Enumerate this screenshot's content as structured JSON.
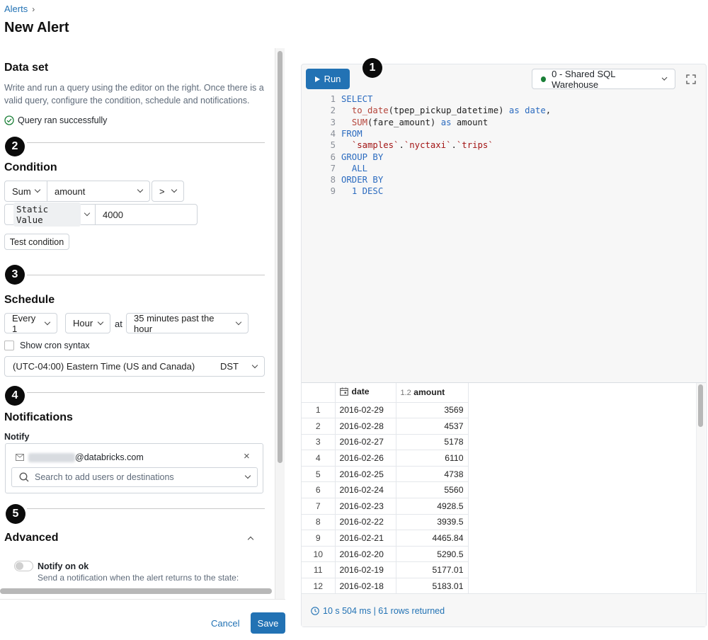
{
  "breadcrumb": {
    "parent": "Alerts",
    "separator": "›"
  },
  "page_title": "New Alert",
  "dataset": {
    "title": "Data set",
    "description": "Write and run a query using the editor on the right. Once there is a valid query, configure the condition, schedule and notifications.",
    "description_line1": "Write and run a query using the editor on the right. Once there is a",
    "description_line2": "valid query, configure the condition, schedule and notifications.",
    "status": "Query ran successfully"
  },
  "badges": [
    "1",
    "2",
    "3",
    "4",
    "5"
  ],
  "condition": {
    "title": "Condition",
    "aggregation": "Sum",
    "column": "amount",
    "operator": ">",
    "value_type": "Static Value",
    "value": "4000",
    "test_button": "Test condition"
  },
  "schedule": {
    "title": "Schedule",
    "every": "Every 1",
    "unit": "Hour",
    "at_label": "at",
    "minutes": "35 minutes past the hour",
    "cron_label": "Show cron syntax",
    "timezone": "(UTC-04:00) Eastern Time (US and Canada)",
    "dst": "DST"
  },
  "notifications": {
    "title": "Notifications",
    "notify_label": "Notify",
    "email_suffix": "@databricks.com",
    "search_placeholder": "Search to add users or destinations"
  },
  "advanced": {
    "title": "Advanced",
    "notify_ok_title": "Notify on ok",
    "notify_ok_desc": "Send a notification when the alert returns to the state:"
  },
  "footer": {
    "cancel": "Cancel",
    "save": "Save"
  },
  "editor": {
    "run_label": "Run",
    "warehouse": "0 - Shared SQL Warehouse",
    "lines": [
      {
        "n": "1",
        "parts": [
          [
            "kw",
            "SELECT"
          ]
        ]
      },
      {
        "n": "2",
        "parts": [
          [
            "txt",
            "  "
          ],
          [
            "fn",
            "to_date"
          ],
          [
            "txt",
            "(tpep_pickup_datetime) "
          ],
          [
            "kw",
            "as date"
          ],
          [
            "txt",
            ","
          ]
        ]
      },
      {
        "n": "3",
        "parts": [
          [
            "txt",
            "  "
          ],
          [
            "fn",
            "SUM"
          ],
          [
            "txt",
            "(fare_amount) "
          ],
          [
            "kw",
            "as"
          ],
          [
            "txt",
            " amount"
          ]
        ]
      },
      {
        "n": "4",
        "parts": [
          [
            "kw",
            "FROM"
          ]
        ]
      },
      {
        "n": "5",
        "parts": [
          [
            "txt",
            "  "
          ],
          [
            "str",
            "`samples`"
          ],
          [
            "txt",
            "."
          ],
          [
            "str",
            "`nyctaxi`"
          ],
          [
            "txt",
            "."
          ],
          [
            "str",
            "`trips`"
          ]
        ]
      },
      {
        "n": "6",
        "parts": [
          [
            "kw",
            "GROUP BY"
          ]
        ]
      },
      {
        "n": "7",
        "parts": [
          [
            "txt",
            "  "
          ],
          [
            "kw",
            "ALL"
          ]
        ]
      },
      {
        "n": "8",
        "parts": [
          [
            "kw",
            "ORDER BY"
          ]
        ]
      },
      {
        "n": "9",
        "parts": [
          [
            "txt",
            "  "
          ],
          [
            "kw",
            "1 DESC"
          ]
        ]
      }
    ]
  },
  "results": {
    "columns": [
      {
        "label": "date",
        "type_icon": "calendar-icon"
      },
      {
        "label": "amount",
        "type_badge": "1.2"
      }
    ],
    "rows": [
      [
        "1",
        "2016-02-29",
        "3569"
      ],
      [
        "2",
        "2016-02-28",
        "4537"
      ],
      [
        "3",
        "2016-02-27",
        "5178"
      ],
      [
        "4",
        "2016-02-26",
        "6110"
      ],
      [
        "5",
        "2016-02-25",
        "4738"
      ],
      [
        "6",
        "2016-02-24",
        "5560"
      ],
      [
        "7",
        "2016-02-23",
        "4928.5"
      ],
      [
        "8",
        "2016-02-22",
        "3939.5"
      ],
      [
        "9",
        "2016-02-21",
        "4465.84"
      ],
      [
        "10",
        "2016-02-20",
        "5290.5"
      ],
      [
        "11",
        "2016-02-19",
        "5177.01"
      ],
      [
        "12",
        "2016-02-18",
        "5183.01"
      ]
    ],
    "summary": "10 s 504 ms | 61 rows returned"
  },
  "colors": {
    "accent": "#2272b4",
    "success": "#1a7f37",
    "badge": "#0b0b0b"
  }
}
